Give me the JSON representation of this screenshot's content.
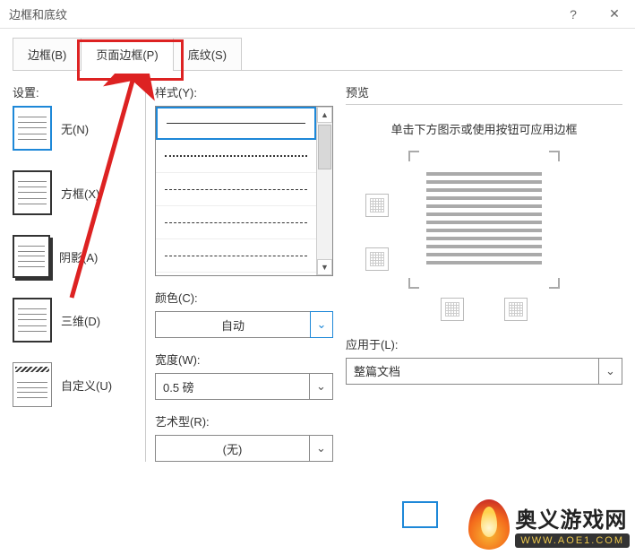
{
  "window": {
    "title": "边框和底纹",
    "help": "?",
    "close": "✕"
  },
  "tabs": {
    "border": "边框(B)",
    "page_border": "页面边框(P)",
    "shading": "底纹(S)"
  },
  "settings": {
    "label": "设置:",
    "none": "无(N)",
    "box": "方框(X)",
    "shadow": "阴影(A)",
    "threeD": "三维(D)",
    "custom": "自定义(U)"
  },
  "style": {
    "label": "样式(Y):",
    "color_label": "颜色(C):",
    "color_value": "自动",
    "width_label": "宽度(W):",
    "width_value": "0.5 磅",
    "art_label": "艺术型(R):",
    "art_value": "(无)"
  },
  "preview": {
    "label": "预览",
    "hint": "单击下方图示或使用按钮可应用边框",
    "apply_label": "应用于(L):",
    "apply_value": "整篇文档"
  },
  "watermark": {
    "name": "奥义游戏网",
    "url": "WWW.AOE1.COM"
  }
}
